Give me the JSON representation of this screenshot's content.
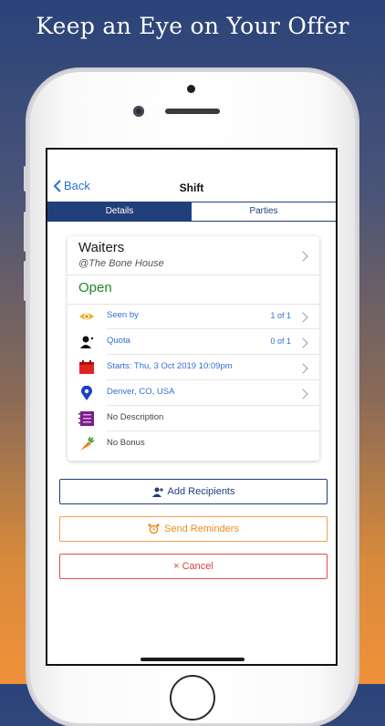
{
  "headline": "Keep an Eye on Your Offer",
  "nav": {
    "back_label": "Back",
    "title": "Shift"
  },
  "tabs": [
    {
      "label": "Details",
      "active": true
    },
    {
      "label": "Parties",
      "active": false
    }
  ],
  "shift": {
    "title": "Waiters",
    "venue": "@The Bone House",
    "status": "Open",
    "status_color": "#1d8a22"
  },
  "rows": {
    "seen_by": {
      "label": "Seen by",
      "value": "1 of 1",
      "icon": "eye-icon"
    },
    "quota": {
      "label": "Quota",
      "value": "0 of 1",
      "icon": "person-icon"
    },
    "starts": {
      "label": "Starts: Thu, 3 Oct 2019 10:09pm",
      "icon": "calendar-icon"
    },
    "location": {
      "label": "Denver, CO, USA",
      "icon": "map-pin-icon"
    },
    "description": {
      "label": "No Description",
      "icon": "notebook-icon"
    },
    "bonus": {
      "label": "No Bonus",
      "icon": "carrot-icon"
    }
  },
  "buttons": {
    "add_recipients": "Add Recipients",
    "send_reminders": "Send Reminders",
    "cancel": "× Cancel"
  },
  "colors": {
    "accent_navy": "#213f7a",
    "link_blue": "#2f6fd0",
    "reminder_orange": "#ef8a1e",
    "cancel_red": "#e03b3b"
  }
}
